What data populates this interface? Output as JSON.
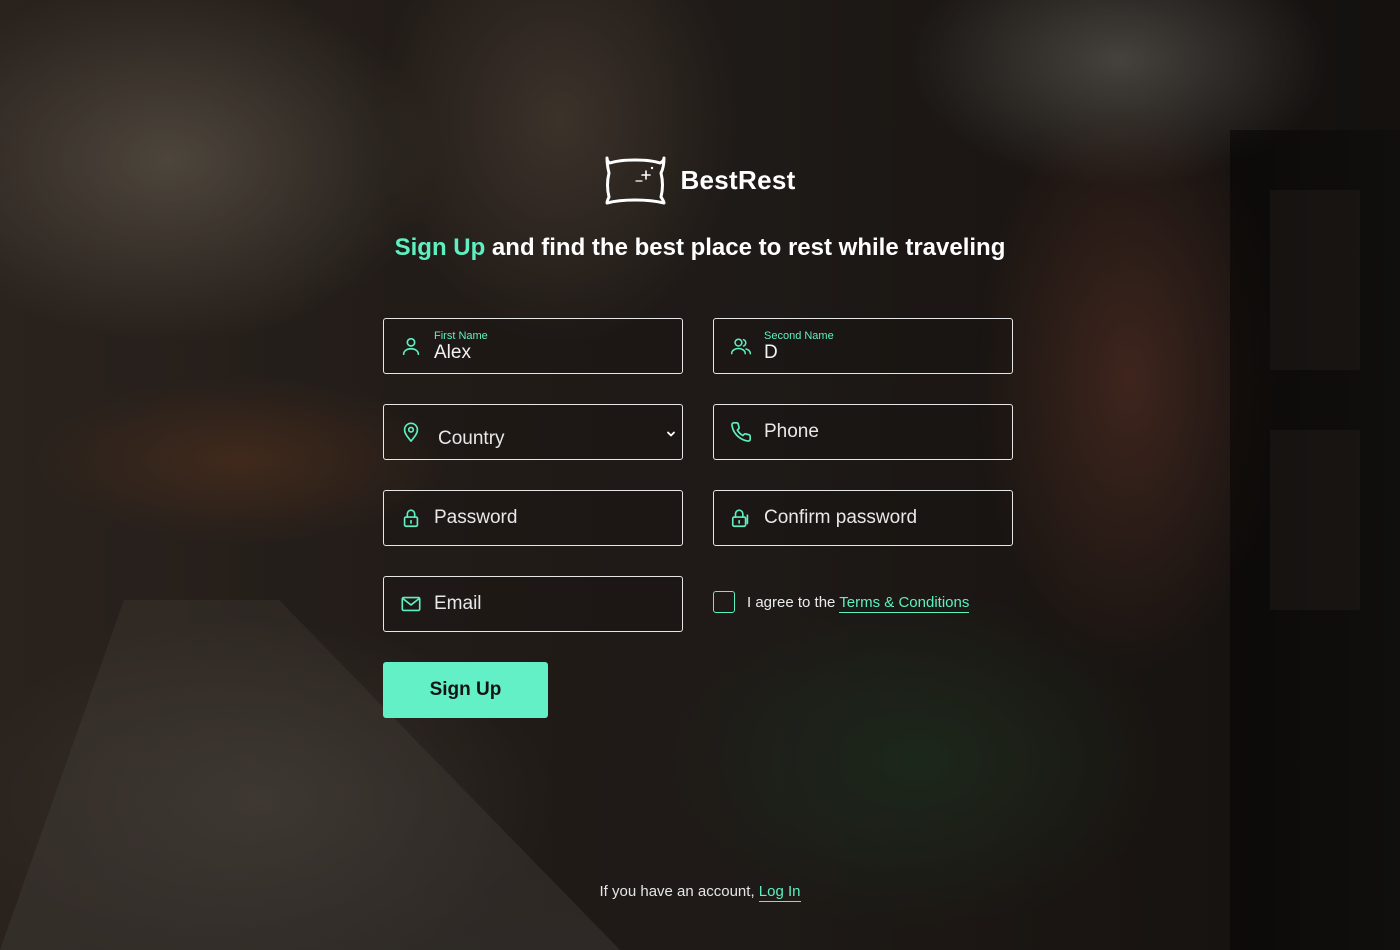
{
  "brand": {
    "name": "BestRest",
    "logo_icon": "pillow-icon"
  },
  "headline": {
    "highlight": "Sign Up",
    "rest": " and find the best place to rest while traveling"
  },
  "form": {
    "first_name": {
      "label": "First Name",
      "value": "Alex",
      "icon": "user-icon"
    },
    "second_name": {
      "label": "Second Name",
      "value": "D",
      "icon": "users-icon"
    },
    "country": {
      "placeholder": "Country",
      "icon": "location-pin-icon"
    },
    "phone": {
      "placeholder": "Phone",
      "icon": "phone-icon"
    },
    "password": {
      "placeholder": "Password",
      "icon": "lock-icon"
    },
    "confirm_password": {
      "placeholder": "Confirm password",
      "icon": "lock-icon"
    },
    "email": {
      "placeholder": "Email",
      "icon": "mail-icon"
    },
    "agree": {
      "prefix": "I agree to the ",
      "link": "Terms & Conditions",
      "checked": false
    },
    "submit_label": "Sign Up"
  },
  "footer": {
    "text": "If you have an account, ",
    "link": "Log In"
  },
  "colors": {
    "accent": "#5ef0c0",
    "button": "#64f0c6",
    "text": "#ffffff"
  }
}
